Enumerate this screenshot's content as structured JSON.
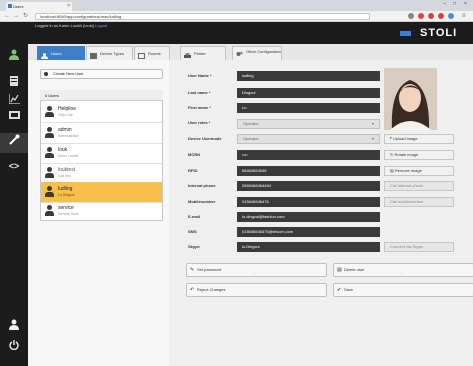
{
  "browser": {
    "tab_title": "Users",
    "url": "localhost:8080/app/configurations/user/ludling",
    "window_controls": [
      "–",
      "□",
      "×"
    ]
  },
  "header": {
    "logged_in_text": "Logged in as Karim Loukili (louki)",
    "logout_label": "Logout",
    "brand": "STOLI"
  },
  "sidebar": {
    "icons": [
      "user-icon",
      "list-icon",
      "chart-icon",
      "screen-icon",
      "wrench-icon",
      "code-icon",
      "person-icon",
      "power-icon"
    ]
  },
  "tabs": [
    "Users",
    "Device Types",
    "Rooms",
    "Printer",
    "Other Configuration"
  ],
  "create_user_label": "Create New User",
  "user_count_label": "6 Users",
  "users": [
    {
      "name": "Helpline",
      "role": "Help Line"
    },
    {
      "name": "admin",
      "role": "Administrator"
    },
    {
      "name": "louk",
      "role": "Karim Loukili"
    },
    {
      "name": "louktest",
      "role": "louk test"
    },
    {
      "name": "ludling",
      "role": "Lu Dingcui"
    },
    {
      "name": "service",
      "role": "Service Desk"
    }
  ],
  "form": {
    "user_name_label": "User Name *",
    "user_name": "ludling",
    "last_name_label": "Last name *",
    "last_name": "Dingcui",
    "first_name_label": "First name *",
    "first_name": "Lu",
    "user_roles_label": "User roles *",
    "user_roles": "Operator",
    "device_usermode_label": "Device Usermode",
    "device_usermode": "Operator",
    "mcrn_label": "MCRN",
    "mcrn": "••••",
    "rfid_label": "RFID",
    "rfid": "56464654546",
    "internal_phone_label": "Internal phone",
    "internal_phone": "0565468464484",
    "mobile_label": "Mobilenumber",
    "mobile": "015646546476",
    "email_label": "E-mail",
    "email": "lu.dingcui@fashion.com",
    "sms_label": "SMS",
    "sms": "015646546476@telcom.com",
    "skype_label": "Skype",
    "skype": "lu.Dingcui"
  },
  "photo_buttons": {
    "upload": "Upload image",
    "rotate": "Rotate image",
    "remove": "Remove image",
    "call_internal": "Call internal phone",
    "call_mobile": "Call mobilenumber",
    "skype": "Connect via Skype"
  },
  "actions": {
    "set_password": "Set password",
    "delete_user": "Delete user",
    "reject": "Reject Changes",
    "save": "Save"
  }
}
